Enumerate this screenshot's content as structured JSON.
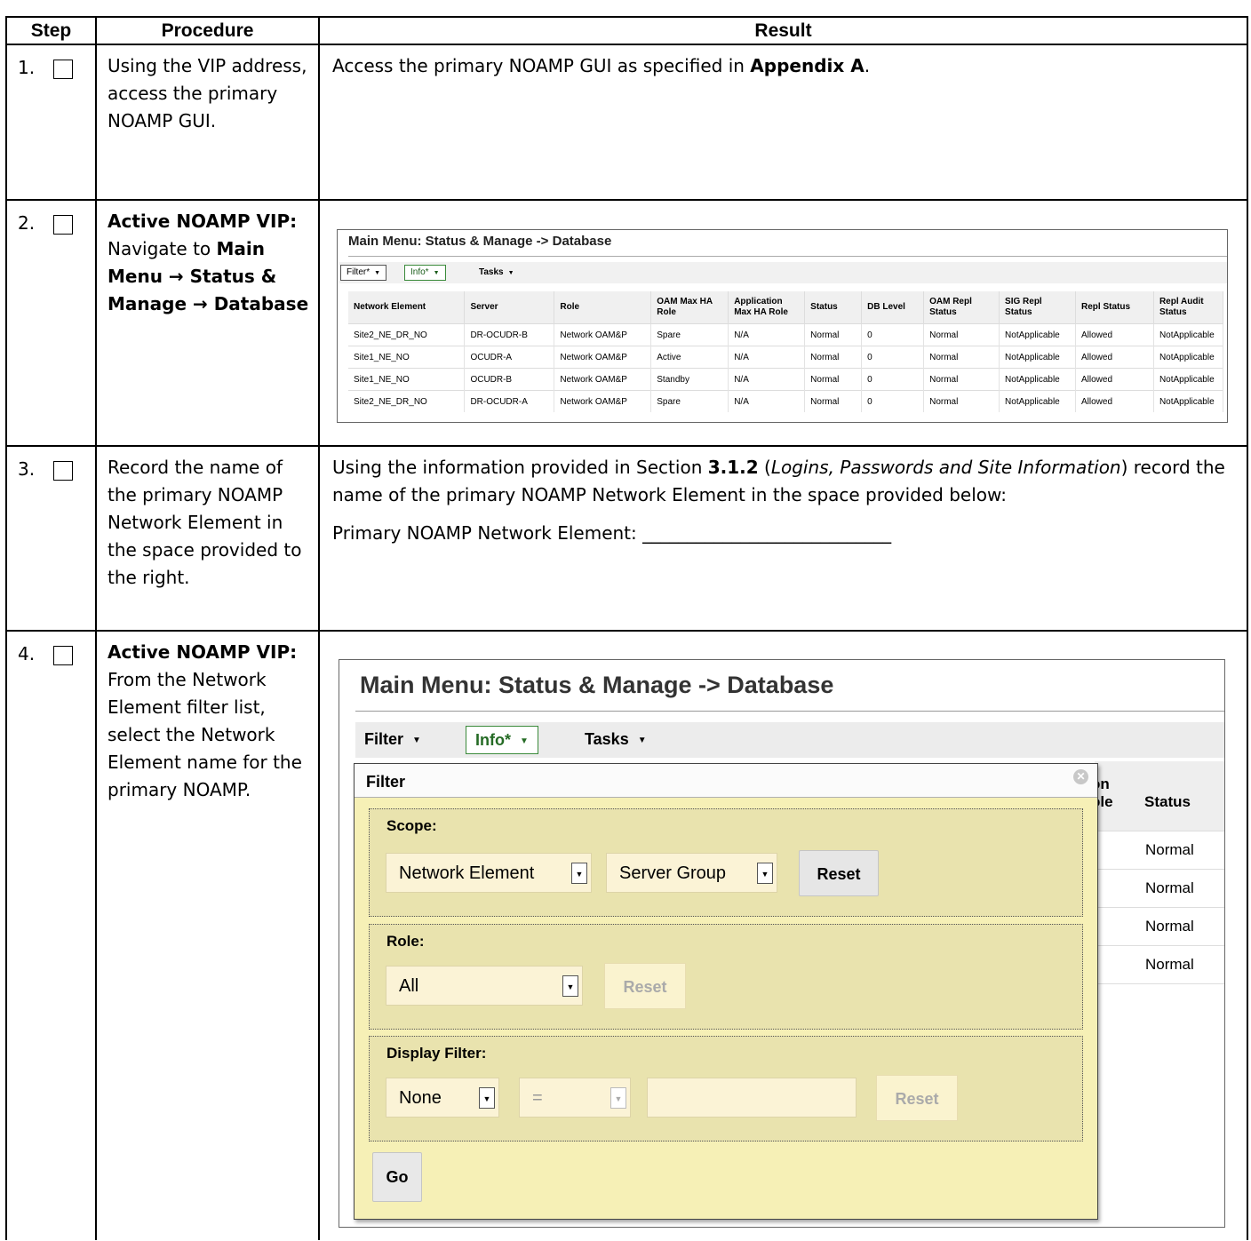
{
  "table": {
    "headers": {
      "step": "Step",
      "procedure": "Procedure",
      "result": "Result"
    }
  },
  "steps": [
    {
      "num": "1.",
      "procedure": "Using the VIP address, access the primary NOAMP GUI.",
      "result": {
        "before": "Access the primary NOAMP GUI as specified in ",
        "bold": "Appendix A",
        "after": "."
      }
    },
    {
      "num": "2.",
      "procedure": {
        "bold1": "Active NOAMP VIP:",
        "text1": "Navigate to ",
        "bold2": "Main Menu → Status & Manage → Database"
      }
    },
    {
      "num": "3.",
      "procedure": "Record the name of the primary NOAMP Network Element in the space provided to the right.",
      "result": {
        "p1_before": "Using the information provided in Section ",
        "p1_bold": "3.1.2",
        "p1_mid": " (",
        "p1_italic": "Logins, Passwords and Site Information",
        "p1_after": ") record the name of the primary NOAMP Network Element in the space provided below:",
        "p2": "Primary NOAMP Network Element: ____________________________"
      }
    },
    {
      "num": "4.",
      "procedure": {
        "bold1": "Active NOAMP VIP:",
        "text1": "From the Network Element filter list, select the Network Element name for the primary NOAMP."
      }
    }
  ],
  "screenshot1": {
    "title": "Main Menu: Status & Manage -> Database",
    "toolbar": {
      "filter": "Filter*",
      "info": "Info*",
      "tasks": "Tasks"
    },
    "columns": [
      "Network Element",
      "Server",
      "Role",
      "OAM Max HA Role",
      "Application Max HA Role",
      "Status",
      "DB Level",
      "OAM Repl Status",
      "SIG Repl Status",
      "Repl Status",
      "Repl Audit Status"
    ],
    "rows": [
      [
        "Site2_NE_DR_NO",
        "DR-OCUDR-B",
        "Network OAM&P",
        "Spare",
        "N/A",
        "Normal",
        "0",
        "Normal",
        "NotApplicable",
        "Allowed",
        "NotApplicable"
      ],
      [
        "Site1_NE_NO",
        "OCUDR-A",
        "Network OAM&P",
        "Active",
        "N/A",
        "Normal",
        "0",
        "Normal",
        "NotApplicable",
        "Allowed",
        "NotApplicable"
      ],
      [
        "Site1_NE_NO",
        "OCUDR-B",
        "Network OAM&P",
        "Standby",
        "N/A",
        "Normal",
        "0",
        "Normal",
        "NotApplicable",
        "Allowed",
        "NotApplicable"
      ],
      [
        "Site2_NE_DR_NO",
        "DR-OCUDR-A",
        "Network OAM&P",
        "Spare",
        "N/A",
        "Normal",
        "0",
        "Normal",
        "NotApplicable",
        "Allowed",
        "NotApplicable"
      ]
    ]
  },
  "screenshot2": {
    "title": "Main Menu: Status & Manage -> Database",
    "toolbar": {
      "filter": "Filter",
      "info": "Info*",
      "tasks": "Tasks"
    },
    "background": {
      "partial_header_1": "on",
      "partial_header_2": "ole",
      "status_header": "Status",
      "status_values": [
        "Normal",
        "Normal",
        "Normal",
        "Normal"
      ]
    },
    "filter_dialog": {
      "title": "Filter",
      "scope": {
        "label": "Scope:",
        "select1": "Network Element",
        "select2": "Server Group",
        "reset": "Reset"
      },
      "role": {
        "label": "Role:",
        "select": "All",
        "reset": "Reset"
      },
      "display_filter": {
        "label": "Display Filter:",
        "field": "None",
        "operator": "=",
        "value": "",
        "reset": "Reset"
      },
      "go": "Go"
    }
  }
}
